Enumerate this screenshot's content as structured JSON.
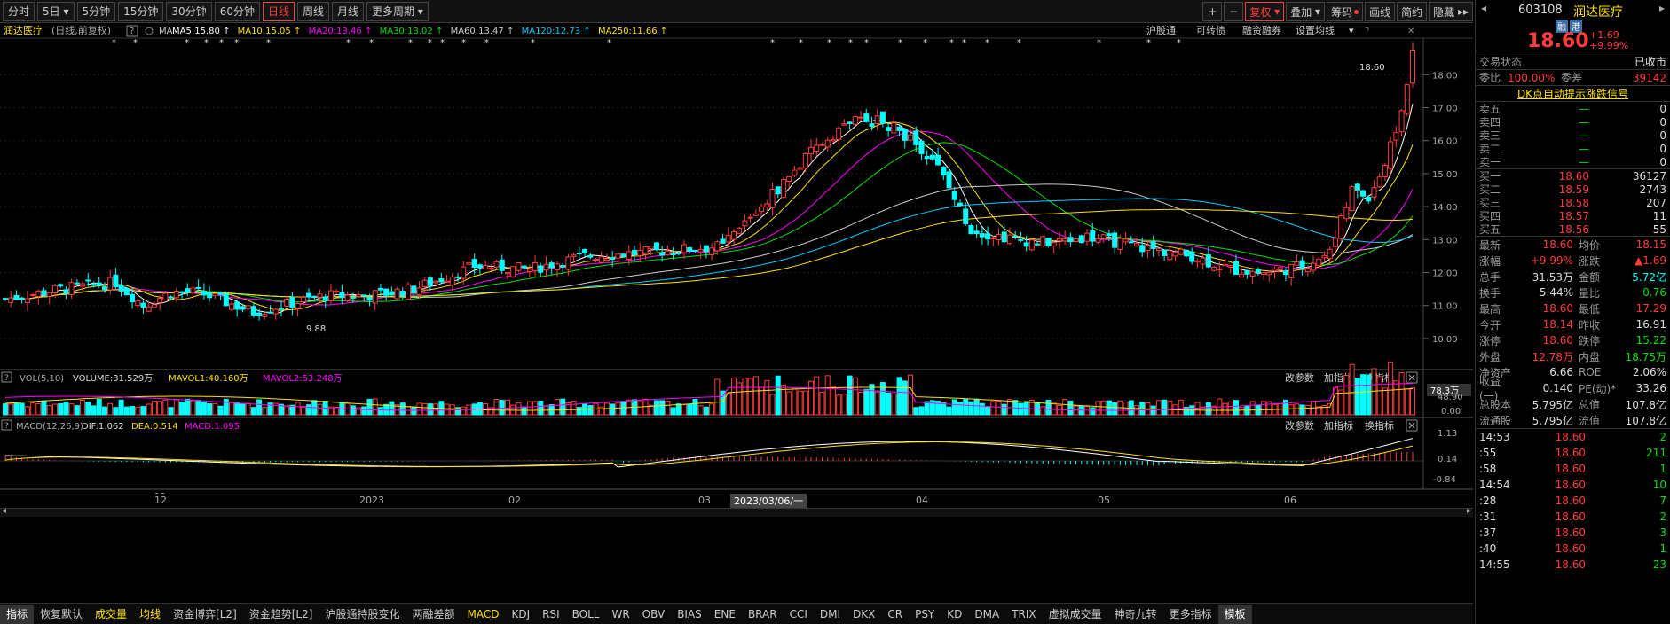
{
  "periods": [
    "分时",
    "5日",
    "5分钟",
    "15分钟",
    "30分钟",
    "60分钟",
    "日线",
    "周线",
    "月线",
    "更多周期"
  ],
  "period_active": "日线",
  "toolbar_right": {
    "plus": "+",
    "minus": "−",
    "fuquan": "复权",
    "diejia": "叠加",
    "chouma": "筹码",
    "huaxian": "画线",
    "jianyue": "简约",
    "yincang": "隐藏"
  },
  "main": {
    "title": "润达医疗",
    "sub": "(日线,前复权)",
    "help": "?",
    "ma_label": "MA",
    "ma": [
      {
        "label": "MA5:15.80",
        "color": "#ffffff"
      },
      {
        "label": "MA10:15.05",
        "color": "#ffe000"
      },
      {
        "label": "MA20:13.46",
        "color": "#ff00ff"
      },
      {
        "label": "MA30:13.02",
        "color": "#00e000"
      },
      {
        "label": "MA60:13.47",
        "color": "#cccccc"
      },
      {
        "label": "MA120:12.73",
        "color": "#00ccff"
      },
      {
        "label": "MA250:11.66",
        "color": "#ffe000"
      }
    ],
    "links": [
      "沪股通",
      "可转债",
      "融资融券",
      "设置均线"
    ],
    "price_labels": [
      "18.00",
      "17.00",
      "16.00",
      "15.00",
      "14.00",
      "13.00",
      "12.00",
      "11.00",
      "10.00"
    ],
    "high_label": "18.60",
    "low_label": "9.88"
  },
  "volume": {
    "help": "?",
    "label": "VOL(5,10)",
    "vol": "VOLUME:31.529万",
    "mavol1": "MAVOL1:40.160万",
    "mavol2": "MAVOL2:53.248万",
    "links": [
      "改参数",
      "加指标",
      "换指标"
    ],
    "scale": [
      "78.3万",
      "48.90",
      "0.00"
    ]
  },
  "macd": {
    "help": "?",
    "label": "MACD(12,26,9)",
    "dif": "DIF:1.062",
    "dea": "DEA:0.514",
    "macd": "MACD:1.095",
    "links": [
      "改参数",
      "加指标",
      "换指标"
    ],
    "scale": [
      "1.13",
      "0.14",
      "-0.84"
    ]
  },
  "dates": [
    "12",
    "2023",
    "02",
    "03",
    "2023/03/06/一",
    "04",
    "05",
    "06"
  ],
  "bottom_tabs": [
    "指标",
    "恢复默认",
    "成交量",
    "均线",
    "资金博弈[L2]",
    "资金趋势[L2]",
    "沪股通持股变化",
    "两融差额",
    "MACD",
    "KDJ",
    "RSI",
    "BOLL",
    "WR",
    "OBV",
    "BIAS",
    "ENE",
    "BRAR",
    "CCI",
    "DMI",
    "DKX",
    "CR",
    "PSY",
    "KD",
    "DMA",
    "TRIX",
    "虚拟成交量",
    "神奇九转",
    "更多指标",
    "模板"
  ],
  "quote": {
    "code": "603108",
    "name": "润达医疗",
    "tag1": "融",
    "tag2": "港",
    "price": "18.60",
    "chg": "+1.69",
    "pct": "+9.99%",
    "status_label": "交易状态",
    "status": "已收市",
    "weibi_label": "委比",
    "weibi": "100.00%",
    "weicha_label": "委差",
    "weicha": "39142",
    "dk_signal": "DK点自动提示涨跌信号",
    "sells": [
      {
        "label": "卖五",
        "price": "—",
        "vol": "0"
      },
      {
        "label": "卖四",
        "price": "—",
        "vol": "0"
      },
      {
        "label": "卖三",
        "price": "—",
        "vol": "0"
      },
      {
        "label": "卖二",
        "price": "—",
        "vol": "0"
      },
      {
        "label": "卖一",
        "price": "—",
        "vol": "0"
      }
    ],
    "buys": [
      {
        "label": "买一",
        "price": "18.60",
        "vol": "36127"
      },
      {
        "label": "买二",
        "price": "18.59",
        "vol": "2743"
      },
      {
        "label": "买三",
        "price": "18.58",
        "vol": "207"
      },
      {
        "label": "买四",
        "price": "18.57",
        "vol": "11"
      },
      {
        "label": "买五",
        "price": "18.56",
        "vol": "55"
      }
    ],
    "stats": [
      {
        "l1": "最新",
        "v1": "18.60",
        "c1": "red",
        "l2": "均价",
        "v2": "18.15",
        "c2": "red"
      },
      {
        "l1": "涨幅",
        "v1": "+9.99%",
        "c1": "red",
        "l2": "涨跌",
        "v2": "▲1.69",
        "c2": "red"
      },
      {
        "l1": "总手",
        "v1": "31.53万",
        "c1": "wh",
        "l2": "金额",
        "v2": "5.72亿",
        "c2": "cy"
      },
      {
        "l1": "换手",
        "v1": "5.44%",
        "c1": "wh",
        "l2": "量比",
        "v2": "0.76",
        "c2": "grn"
      },
      {
        "l1": "最高",
        "v1": "18.60",
        "c1": "red",
        "l2": "最低",
        "v2": "17.29",
        "c2": "red"
      },
      {
        "l1": "今开",
        "v1": "18.14",
        "c1": "red",
        "l2": "昨收",
        "v2": "16.91",
        "c2": "wh"
      },
      {
        "l1": "涨停",
        "v1": "18.60",
        "c1": "red",
        "l2": "跌停",
        "v2": "15.22",
        "c2": "grn"
      },
      {
        "l1": "外盘",
        "v1": "12.78万",
        "c1": "red",
        "l2": "内盘",
        "v2": "18.75万",
        "c2": "grn"
      },
      {
        "l1": "净资产",
        "v1": "6.66",
        "c1": "wh",
        "l2": "ROE",
        "v2": "2.06%",
        "c2": "wh"
      },
      {
        "l1": "收益(一)",
        "v1": "0.140",
        "c1": "wh",
        "l2": "PE(动)*",
        "v2": "33.26",
        "c2": "wh"
      },
      {
        "l1": "总股本",
        "v1": "5.795亿",
        "c1": "wh",
        "l2": "总值",
        "v2": "107.8亿",
        "c2": "wh"
      },
      {
        "l1": "流通股",
        "v1": "5.795亿",
        "c1": "wh",
        "l2": "流值",
        "v2": "107.8亿",
        "c2": "wh"
      }
    ],
    "ticks": [
      {
        "time": "14:53",
        "price": "18.60",
        "vol": "2"
      },
      {
        "time": ":55",
        "price": "18.60",
        "vol": "211"
      },
      {
        "time": ":58",
        "price": "18.60",
        "vol": "1"
      },
      {
        "time": "14:54",
        "price": "18.60",
        "vol": "10"
      },
      {
        "time": ":28",
        "price": "18.60",
        "vol": "7"
      },
      {
        "time": ":31",
        "price": "18.60",
        "vol": "2"
      },
      {
        "time": ":37",
        "price": "18.60",
        "vol": "3"
      },
      {
        "time": ":40",
        "price": "18.60",
        "vol": "1"
      },
      {
        "time": "14:55",
        "price": "18.60",
        "vol": "23"
      }
    ]
  },
  "colors": {
    "up": "#ff3b3b",
    "down": "#00ffff",
    "bg": "#000000",
    "grid": "#222222"
  }
}
